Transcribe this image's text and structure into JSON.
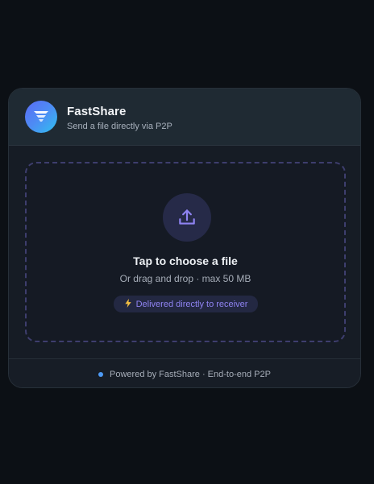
{
  "app": {
    "name": "FastShare",
    "tagline": "Send a file directly via P2P"
  },
  "dropzone": {
    "title": "Tap to choose a file",
    "subtitle": "Or drag and drop · max 50 MB",
    "badge": "Delivered directly to receiver"
  },
  "footer": {
    "text": "Powered by FastShare · End-to-end P2P"
  },
  "colors": {
    "accent": "#8f83f2",
    "status_dot": "#4d9af5",
    "bolt": "#f4c043"
  },
  "icons": {
    "logo": "funnel-logo-icon",
    "upload": "upload-icon",
    "badge": "lightning-bolt-icon"
  }
}
